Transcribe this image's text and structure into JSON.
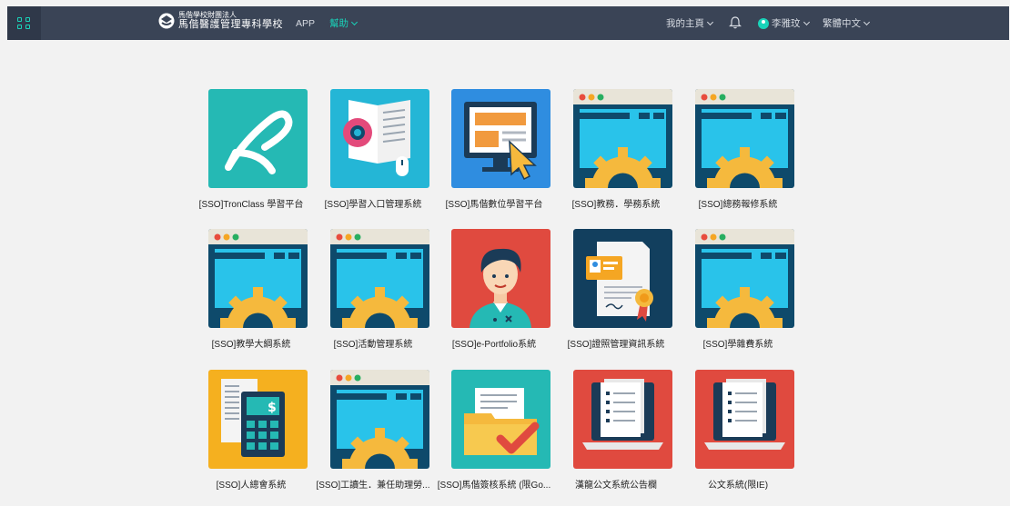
{
  "topbar": {
    "school_sub": "馬偕學校財團法人",
    "school_main": "馬偕醫護管理專科學校",
    "nav_app": "APP",
    "nav_help": "幫助",
    "my_home": "我的主頁",
    "user_name": "李雅玟",
    "language": "繁體中文"
  },
  "colors": {
    "topbar": "#3a4456",
    "accent": "#19d3b9"
  },
  "tiles": [
    {
      "label": "[SSO]TronClass 學習平台",
      "icon": "tronclass-icon"
    },
    {
      "label": "[SSO]學習入口管理系統",
      "icon": "learning-portal-icon"
    },
    {
      "label": "[SSO]馬偕數位學習平台",
      "icon": "digital-learning-icon"
    },
    {
      "label": "[SSO]教務．學務系統",
      "icon": "system-gear-icon"
    },
    {
      "label": "[SSO]總務報修系統",
      "icon": "system-gear-icon"
    },
    {
      "label": "[SSO]教學大綱系統",
      "icon": "system-gear-icon"
    },
    {
      "label": "[SSO]活動管理系統",
      "icon": "system-gear-icon"
    },
    {
      "label": "[SSO]e-Portfolio系統",
      "icon": "eportfolio-icon"
    },
    {
      "label": "[SSO]證照管理資訊系統",
      "icon": "certificate-icon"
    },
    {
      "label": "[SSO]學雜費系統",
      "icon": "system-gear-icon"
    },
    {
      "label": "[SSO]人總會系統",
      "icon": "calculator-icon"
    },
    {
      "label": "[SSO]工讀生．兼任助理勞...",
      "icon": "system-gear-icon"
    },
    {
      "label": "[SSO]馬偕簽核系統 (限Go...",
      "icon": "approval-folder-icon"
    },
    {
      "label": "漢龍公文系統公告欄",
      "icon": "document-laptop-icon"
    },
    {
      "label": "公文系統(限IE)",
      "icon": "document-laptop-icon"
    }
  ]
}
